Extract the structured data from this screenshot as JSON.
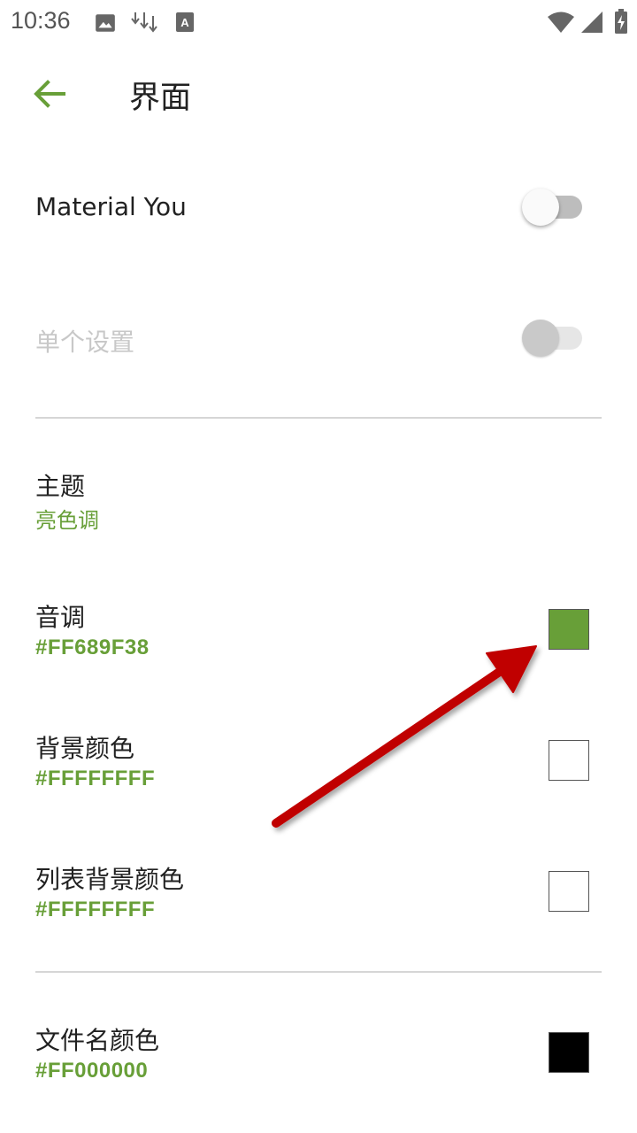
{
  "status_bar": {
    "time": "10:36",
    "icons_left": [
      "image-icon",
      "download-icon",
      "font-icon"
    ],
    "icons_right": [
      "wifi-icon",
      "signal-icon",
      "battery-charging-icon"
    ]
  },
  "toolbar": {
    "back_icon": "arrow-left-icon",
    "title": "界面",
    "accent_color": "#689F38"
  },
  "settings": {
    "material_you": {
      "label": "Material You",
      "enabled": false
    },
    "single_setting": {
      "label": "单个设置",
      "enabled": false,
      "disabled": true
    },
    "theme": {
      "label": "主题",
      "value": "亮色调"
    },
    "tone": {
      "label": "音调",
      "value": "#FF689F38",
      "color": "#689F38"
    },
    "background_color": {
      "label": "背景颜色",
      "value": "#FFFFFFFF",
      "color": "#FFFFFF"
    },
    "list_background_color": {
      "label": "列表背景颜色",
      "value": "#FFFFFFFF",
      "color": "#FFFFFF"
    },
    "file_name_color": {
      "label": "文件名颜色",
      "value": "#FF000000",
      "color": "#000000"
    }
  },
  "annotation": {
    "type": "arrow",
    "color": "#C00000"
  }
}
